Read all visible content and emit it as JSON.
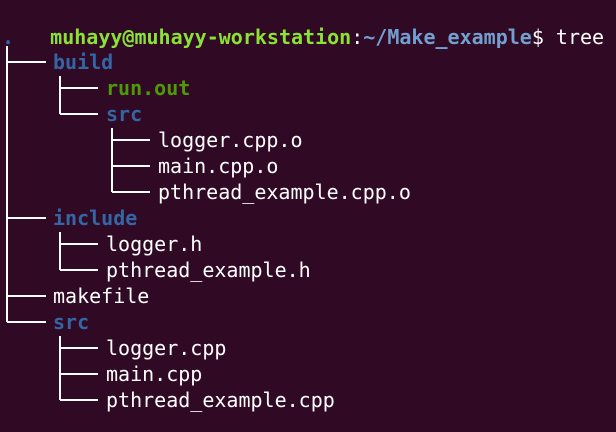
{
  "prompt": {
    "user_host": "muhayy@muhayy-workstation",
    "separator": ":",
    "path": "~/Make_example",
    "symbol": "$",
    "command": " tree"
  },
  "tree": {
    "root": ".",
    "entries": [
      {
        "name": "build",
        "type": "dir",
        "depth": 0
      },
      {
        "name": "run.out",
        "type": "exe",
        "depth": 1
      },
      {
        "name": "src",
        "type": "dir",
        "depth": 1
      },
      {
        "name": "logger.cpp.o",
        "type": "file",
        "depth": 2
      },
      {
        "name": "main.cpp.o",
        "type": "file",
        "depth": 2
      },
      {
        "name": "pthread_example.cpp.o",
        "type": "file",
        "depth": 2
      },
      {
        "name": "include",
        "type": "dir",
        "depth": 0
      },
      {
        "name": "logger.h",
        "type": "file",
        "depth": 1
      },
      {
        "name": "pthread_example.h",
        "type": "file",
        "depth": 1
      },
      {
        "name": "makefile",
        "type": "file",
        "depth": 0
      },
      {
        "name": "src",
        "type": "dir",
        "depth": 0
      },
      {
        "name": "logger.cpp",
        "type": "file",
        "depth": 1
      },
      {
        "name": "main.cpp",
        "type": "file",
        "depth": 1
      },
      {
        "name": "pthread_example.cpp",
        "type": "file",
        "depth": 1
      }
    ]
  },
  "colors": {
    "background": "#300a24",
    "prompt_user": "#8ae234",
    "prompt_path": "#729fcf",
    "directory": "#3465a4",
    "executable": "#4e9a06",
    "file": "#ffffff"
  }
}
